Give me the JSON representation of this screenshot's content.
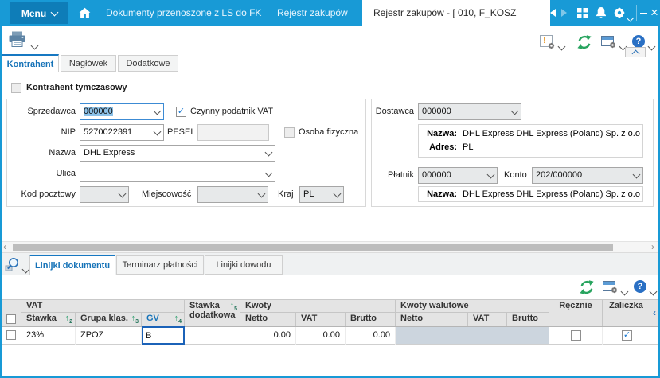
{
  "titlebar": {
    "menu_label": "Menu",
    "tab_documents": "Dokumenty przenoszone z LS do FK",
    "tab_register": "Rejestr zakupów",
    "tab_active": "Rejestr zakupów - [ 010, F_KOSZ",
    "close_glyph": "×"
  },
  "toolbar": {
    "warning_glyph": "!",
    "help_glyph": "?"
  },
  "page_tabs": {
    "kontrahent": "Kontrahent",
    "naglowek": "Nagłówek",
    "dodatkowe": "Dodatkowe"
  },
  "form": {
    "temp_contractor": "Kontrahent tymczasowy",
    "sprzedawca_label": "Sprzedawca",
    "sprzedawca_value": "000000",
    "czynny_vat_label": "Czynny podatnik VAT",
    "czynny_vat_check": "✓",
    "nip_label": "NIP",
    "nip_value": "5270022391",
    "pesel_label": "PESEL",
    "pesel_value": "",
    "osoba_fizyczna_label": "Osoba fizyczna",
    "nazwa_label": "Nazwa",
    "nazwa_value": "DHL Express",
    "ulica_label": "Ulica",
    "ulica_value": "",
    "kod_pocztowy_label": "Kod pocztowy",
    "kod_pocztowy_value": "",
    "miejscowosc_label": "Miejscowość",
    "miejscowosc_value": "",
    "kraj_label": "Kraj",
    "kraj_value": "PL"
  },
  "supplier_panel": {
    "dostawca_label": "Dostawca",
    "dostawca_value": "000000",
    "nazwa_label": "Nazwa:",
    "nazwa_value": "DHL Express DHL Express (Poland) Sp. z o.o",
    "adres_label": "Adres:",
    "adres_value": "PL",
    "platnik_label": "Płatnik",
    "platnik_value": "000000",
    "konto_label": "Konto",
    "konto_value": "202/000000",
    "platnik_nazwa_label": "Nazwa:",
    "platnik_nazwa_value": "DHL Express DHL Express (Poland) Sp. z o.o"
  },
  "scrollbar": {
    "left_glyph": "‹",
    "right_glyph": "›"
  },
  "detail_tabs": {
    "linijki_dokumentu": "Linijki dokumentu",
    "terminarz_platnosci": "Terminarz płatności",
    "linijki_dowodu": "Linijki dowodu"
  },
  "detail_toolbar": {
    "help_glyph": "?"
  },
  "table": {
    "group_vat": "VAT",
    "group_kwoty": "Kwoty",
    "group_kwoty_walutowe": "Kwoty walutowe",
    "col_stawka": "Stawka",
    "col_grupa_klas": "Grupa klas.",
    "col_gv": "GV",
    "col_stawka_dodatkowa_l1": "Stawka",
    "col_stawka_dodatkowa_l2": "dodatkowa",
    "col_netto": "Netto",
    "col_vat": "VAT",
    "col_brutto": "Brutto",
    "col_wal_netto": "Netto",
    "col_wal_vat": "VAT",
    "col_wal_brutto": "Brutto",
    "col_recznie": "Ręcznie",
    "col_zaliczka": "Zaliczka",
    "sort_arrow": "↑",
    "sort_stawka": "2",
    "sort_grupa_klas": "3",
    "sort_gv": "4",
    "sort_stawka_dodatkowa": "5",
    "collapse_glyph": "‹",
    "row": {
      "stawka": "23%",
      "grupa_klas": "ZPOZ",
      "gv": "B",
      "stawka_dodatkowa": "",
      "netto": "0.00",
      "vat": "0.00",
      "brutto": "0.00",
      "zaliczka_check": "✓"
    }
  },
  "colors": {
    "titlebar_blue": "#189ad6",
    "accent_blue": "#1673b8",
    "refresh_green": "#28a45f",
    "check_blue": "#1576d1",
    "disabled_cell": "#ccd5de"
  }
}
